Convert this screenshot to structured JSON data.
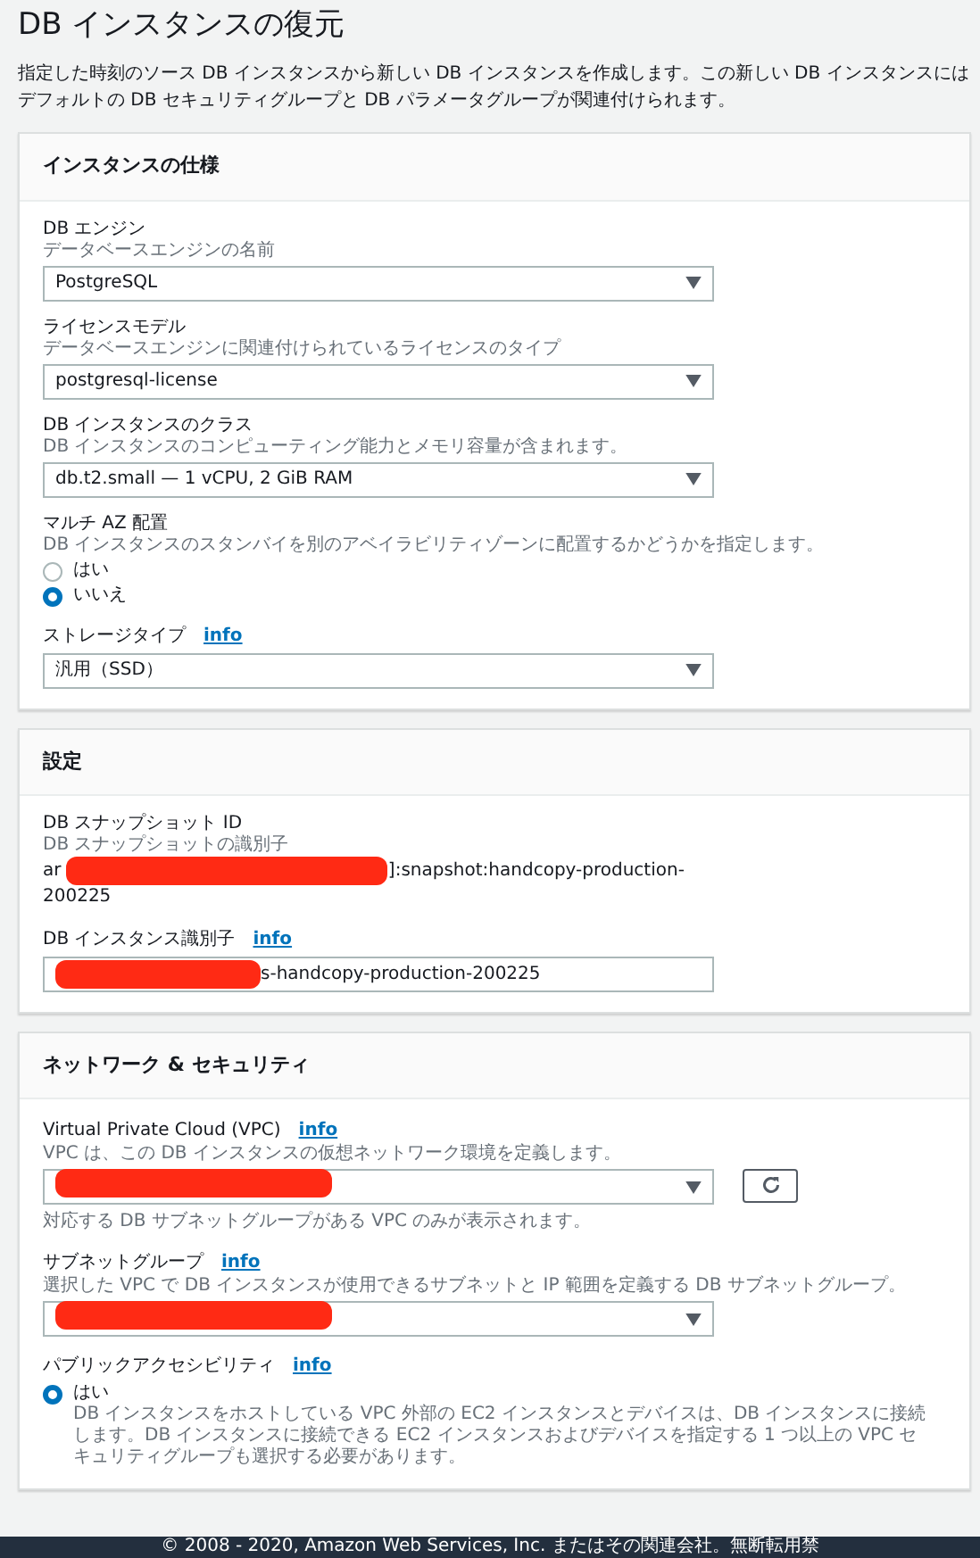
{
  "page": {
    "title": "DB インスタンスの復元",
    "description": "指定した時刻のソース DB インスタンスから新しい DB インスタンスを作成します。この新しい DB インスタンスにはデフォルトの DB セキュリティグループと DB パラメータグループが関連付けられます。"
  },
  "sections": [
    {
      "title": "インスタンスの仕様",
      "fields": [
        {
          "kind": "select",
          "label": "DB エンジン",
          "hint": "データベースエンジンの名前",
          "value": "PostgreSQL"
        },
        {
          "kind": "select",
          "label": "ライセンスモデル",
          "hint": "データベースエンジンに関連付けられているライセンスのタイプ",
          "value": "postgresql-license"
        },
        {
          "kind": "select",
          "label": "DB インスタンスのクラス",
          "hint": "DB インスタンスのコンピューティング能力とメモリ容量が含まれます。",
          "value": "db.t2.small — 1 vCPU, 2 GiB RAM"
        },
        {
          "kind": "radio",
          "label": "マルチ AZ 配置",
          "hint": "DB インスタンスのスタンバイを別のアベイラビリティゾーンに配置するかどうかを指定します。",
          "options": [
            {
              "label": "はい",
              "selected": false
            },
            {
              "label": "いいえ",
              "selected": true
            }
          ]
        },
        {
          "kind": "select",
          "label": "ストレージタイプ",
          "info": "info",
          "value": "汎用（SSD）"
        }
      ]
    },
    {
      "title": "設定",
      "fields": [
        {
          "kind": "text",
          "label": "DB スナップショット ID",
          "hint": "DB スナップショットの識別子",
          "value_start": "ar",
          "value": "]:snapshot:handcopy-production-200225",
          "redacted": true
        },
        {
          "kind": "input",
          "label": "DB インスタンス識別子",
          "info": "info",
          "value": "s-handcopy-production-200225",
          "redacted": true
        }
      ]
    },
    {
      "title": "ネットワーク & セキュリティ",
      "fields": [
        {
          "kind": "select",
          "label": "Virtual Private Cloud (VPC)",
          "info": "info",
          "hint": "VPC は、この DB インスタンスの仮想ネットワーク環境を定義します。",
          "redacted": true,
          "refresh": true,
          "note": "対応する DB サブネットグループがある VPC のみが表示されます。"
        },
        {
          "kind": "select",
          "label": "サブネットグループ",
          "info": "info",
          "hint": "選択した VPC で DB インスタンスが使用できるサブネットと IP 範囲を定義する DB サブネットグループ。",
          "redacted": true
        },
        {
          "kind": "radio",
          "label": "パブリックアクセシビリティ",
          "info": "info",
          "options": [
            {
              "label": "はい",
              "selected": true,
              "description": "DB インスタンスをホストしている VPC 外部の EC2 インスタンスとデバイスは、DB インスタンスに接続します。DB インスタンスに接続できる EC2 インスタンスおよびデバイスを指定する 1 つ以上の VPC セキュリティグループも選択する必要があります。"
            }
          ]
        }
      ]
    }
  ],
  "footer": {
    "text": "© 2008 - 2020, Amazon Web Services, Inc. またはその関連会社。無断転用禁"
  }
}
